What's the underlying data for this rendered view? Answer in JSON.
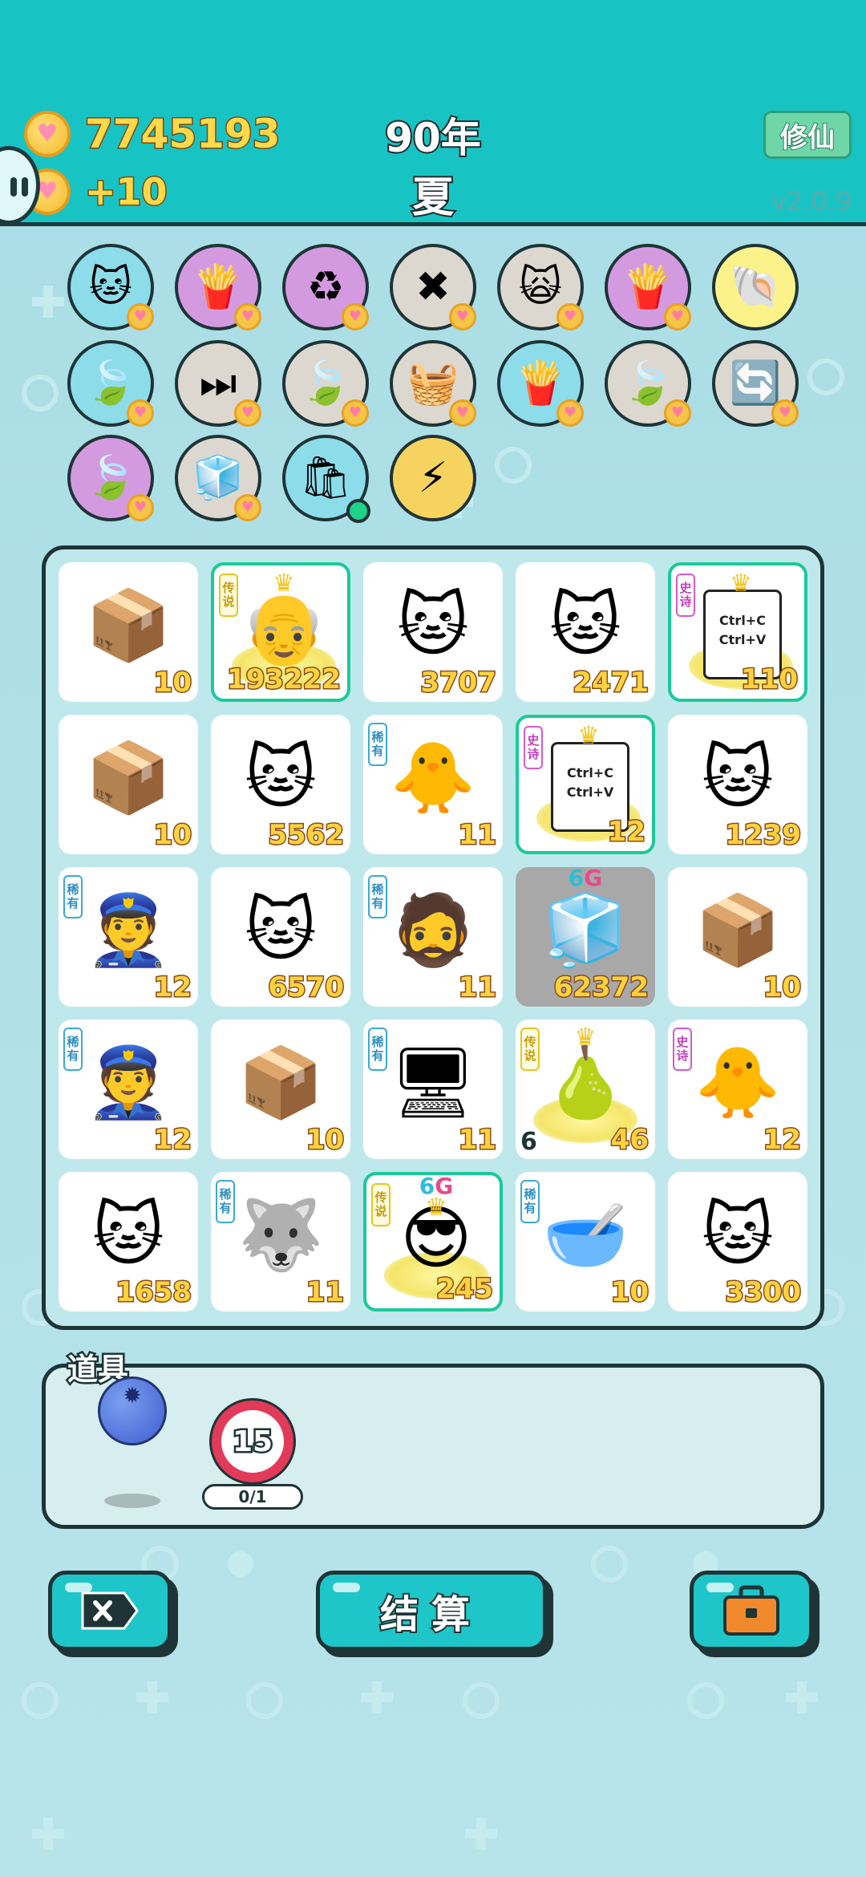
{
  "header": {
    "coins": "7745193",
    "income": "+10",
    "year": "90年",
    "season": "夏",
    "xiuxian_label": "修仙",
    "version": "v2.0.9"
  },
  "skills": [
    {
      "icon": "cat-skill-icon",
      "glyph": "🐱",
      "color": "#8cdcea"
    },
    {
      "icon": "fries-icon",
      "glyph": "🍟",
      "color": "#d49ae0"
    },
    {
      "icon": "recycle-icon",
      "glyph": "♻",
      "color": "#d49ae0"
    },
    {
      "icon": "delete-tag-icon",
      "glyph": "✖",
      "color": "#dcd7cf"
    },
    {
      "icon": "goggle-cats-icon",
      "glyph": "🙀",
      "color": "#dcd7cf"
    },
    {
      "icon": "fries-icon",
      "glyph": "🍟",
      "color": "#d49ae0"
    },
    {
      "icon": "shell-icon",
      "glyph": "🐚",
      "color": "#fbf38a"
    },
    {
      "icon": "leaf-icon",
      "glyph": "🍃",
      "color": "#8cdcea"
    },
    {
      "icon": "skip-icon",
      "glyph": "⏭",
      "color": "#dcd7cf"
    },
    {
      "icon": "leaf-icon",
      "glyph": "🍃",
      "color": "#dcd7cf"
    },
    {
      "icon": "basket-icon",
      "glyph": "🧺",
      "color": "#dcd7cf"
    },
    {
      "icon": "fries-icon",
      "glyph": "🍟",
      "color": "#8cdcea"
    },
    {
      "icon": "leaf-icon",
      "glyph": "🍃",
      "color": "#dcd7cf"
    },
    {
      "icon": "refresh-icon",
      "glyph": "🔄",
      "color": "#dcd7cf"
    },
    {
      "icon": "leaf-icon",
      "glyph": "🍃",
      "color": "#d49ae0"
    },
    {
      "icon": "sugar-cubes-icon",
      "glyph": "🧊",
      "color": "#dcd7cf"
    },
    {
      "icon": "garbage-bag-icon",
      "glyph": "🛍",
      "color": "#8cdcea"
    },
    {
      "icon": "lightning-icon",
      "glyph": "⚡",
      "color": "#f6d35f"
    }
  ],
  "board": [
    [
      {
        "icon": "box-icon",
        "glyph": "📦",
        "count": "10"
      },
      {
        "icon": "old-man-king-icon",
        "glyph": "👴",
        "count": "193222",
        "tag": "传说",
        "tag_type": "legend",
        "crown": true,
        "highlight": true,
        "glow": true
      },
      {
        "icon": "cat-icon",
        "glyph": "🐱",
        "count": "3707"
      },
      {
        "icon": "cat-icon",
        "glyph": "🐱",
        "count": "2471"
      },
      {
        "icon": "ctrl-cv-icon",
        "glyph": "",
        "count": "110",
        "tag": "史诗",
        "tag_type": "epic",
        "crown": true,
        "highlight": true,
        "glow": true,
        "card": [
          "Ctrl+C",
          "Ctrl+V"
        ]
      }
    ],
    [
      {
        "icon": "box-icon",
        "glyph": "📦",
        "count": "10"
      },
      {
        "icon": "cat-icon",
        "glyph": "🐱",
        "count": "5562"
      },
      {
        "icon": "chick-icon",
        "glyph": "🐥",
        "count": "11",
        "tag": "稀有",
        "tag_type": "rare"
      },
      {
        "icon": "ctrl-cv-icon",
        "glyph": "",
        "count": "12",
        "tag": "史诗",
        "tag_type": "epic",
        "crown": true,
        "highlight": true,
        "glow": true,
        "card": [
          "Ctrl+C",
          "Ctrl+V"
        ]
      },
      {
        "icon": "cat-icon",
        "glyph": "🐱",
        "count": "1239"
      }
    ],
    [
      {
        "icon": "police-icon",
        "glyph": "👮",
        "count": "12",
        "tag": "稀有",
        "tag_type": "rare"
      },
      {
        "icon": "cat-icon",
        "glyph": "🐱",
        "count": "6570"
      },
      {
        "icon": "bucket-hat-man-icon",
        "glyph": "🧔",
        "count": "11",
        "tag": "稀有",
        "tag_type": "rare"
      },
      {
        "icon": "fridge-icon",
        "glyph": "🧊",
        "count": "62372",
        "sixg": true,
        "gray": true
      },
      {
        "icon": "box-icon",
        "glyph": "📦",
        "count": "10"
      }
    ],
    [
      {
        "icon": "police-icon",
        "glyph": "👮",
        "count": "12",
        "tag": "稀有",
        "tag_type": "rare"
      },
      {
        "icon": "box-icon",
        "glyph": "📦",
        "count": "10"
      },
      {
        "icon": "pc-tower-icon",
        "glyph": "🖥",
        "count": "11",
        "tag": "稀有",
        "tag_type": "rare"
      },
      {
        "icon": "pear-king-icon",
        "glyph": "🍐",
        "count": "46",
        "tag": "传说",
        "tag_type": "legend",
        "crown": true,
        "glow": true,
        "level": "6"
      },
      {
        "icon": "yellow-face-icon",
        "glyph": "🐥",
        "count": "12",
        "tag": "史诗",
        "tag_type": "epic"
      }
    ],
    [
      {
        "icon": "cat-icon",
        "glyph": "🐱",
        "count": "1658"
      },
      {
        "icon": "husky-icon",
        "glyph": "🐺",
        "count": "11",
        "tag": "稀有",
        "tag_type": "rare"
      },
      {
        "icon": "sunglasses-boss-icon",
        "glyph": "😎",
        "count": "245",
        "tag": "传说",
        "tag_type": "legend",
        "crown": true,
        "highlight": true,
        "glow": true,
        "sixg": true
      },
      {
        "icon": "ball-bowl-icon",
        "glyph": "🥣",
        "count": "10",
        "tag": "稀有",
        "tag_type": "rare"
      },
      {
        "icon": "cat-icon",
        "glyph": "🐱",
        "count": "3300"
      }
    ]
  ],
  "sixg": {
    "six": "6",
    "g": "G"
  },
  "items": {
    "label": "道具",
    "limit_value": "15",
    "limit_progress": "0/1"
  },
  "buttons": {
    "settle_label": "结算"
  },
  "colors": {
    "header": "#18c4c3",
    "button": "#1fc6c9",
    "count_text": "#ffd23f",
    "outline": "#1e3436"
  }
}
